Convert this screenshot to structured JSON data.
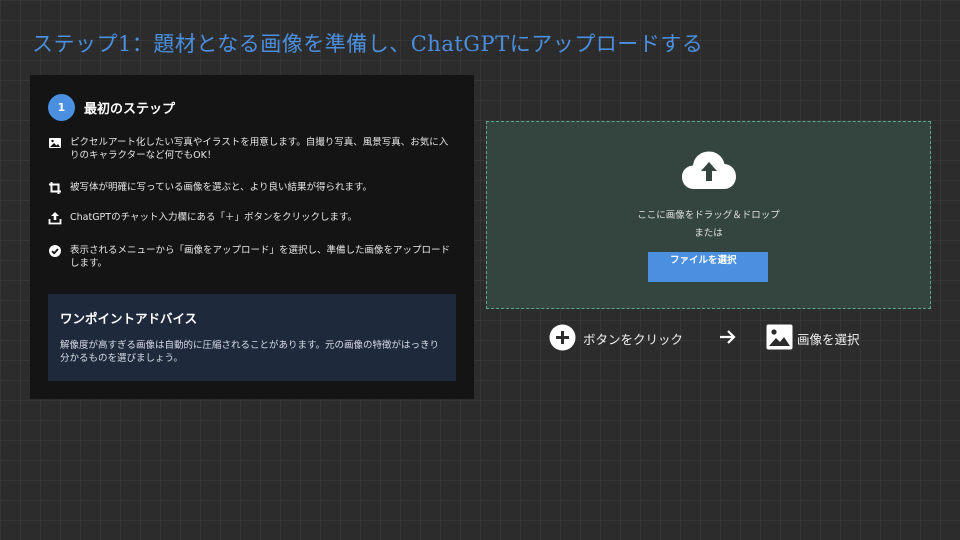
{
  "title": "ステップ1：題材となる画像を準備し、ChatGPTにアップロードする",
  "step": {
    "number": "1",
    "heading": "最初のステップ",
    "items": [
      {
        "icon": "image-icon",
        "text": "ピクセルアート化したい写真やイラストを用意します。自撮り写真、風景写真、お気に入りのキャラクターなど何でもOK！"
      },
      {
        "icon": "crop-icon",
        "text": "被写体が明確に写っている画像を選ぶと、より良い結果が得られます。"
      },
      {
        "icon": "upload-icon",
        "text": "ChatGPTのチャット入力欄にある「＋」ボタンをクリックします。"
      },
      {
        "icon": "check-circle-icon",
        "text": "表示されるメニューから「画像をアップロード」を選択し、準備した画像をアップロードします。"
      }
    ]
  },
  "advice": {
    "title": "ワンポイントアドバイス",
    "text": "解像度が高すぎる画像は自動的に圧縮されることがあります。元の画像の特徴がはっきり分かるものを選びましょう。"
  },
  "dropzone": {
    "icon": "cloud-upload-icon",
    "line1": "ここに画像をドラッグ＆ドロップ",
    "line2": "または",
    "button": "ファイルを選択"
  },
  "flow": {
    "step1_label": "ボタンをクリック",
    "step2_label": "画像を選択",
    "icons": [
      "plus-circle-icon",
      "arrow-right-icon",
      "image-icon"
    ]
  },
  "colors": {
    "accent": "#4a8fe0",
    "background": "#2c2c2c",
    "panel": "#141414",
    "advice_bg": "#1e2a3c",
    "dropzone_bg": "#34443e",
    "dropzone_border": "#5ea88a"
  }
}
